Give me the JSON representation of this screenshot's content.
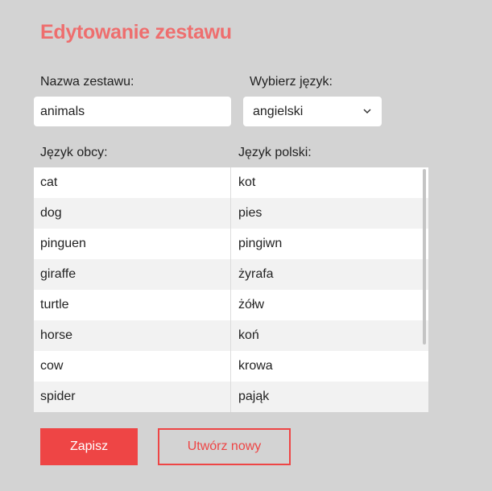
{
  "header": {
    "title": "Edytowanie zestawu"
  },
  "form": {
    "name_label": "Nazwa zestawu:",
    "name_value": "animals",
    "language_label": "Wybierz język:",
    "language_value": "angielski"
  },
  "table": {
    "col_foreign": "Język obcy:",
    "col_polish": "Język polski:",
    "rows": [
      {
        "foreign": "cat",
        "polish": "kot"
      },
      {
        "foreign": "dog",
        "polish": "pies"
      },
      {
        "foreign": "pinguen",
        "polish": "pingiwn"
      },
      {
        "foreign": "giraffe",
        "polish": "żyrafa"
      },
      {
        "foreign": "turtle",
        "polish": "żółw"
      },
      {
        "foreign": "horse",
        "polish": "koń"
      },
      {
        "foreign": "cow",
        "polish": "krowa"
      },
      {
        "foreign": "spider",
        "polish": "pająk"
      }
    ]
  },
  "actions": {
    "save_label": "Zapisz",
    "new_label": "Utwórz nowy"
  },
  "icons": {
    "select_arrow": "chevron-down-icon"
  },
  "colors": {
    "background": "#d3d3d3",
    "title": "#ee6e6e",
    "accent": "#ee4545"
  }
}
